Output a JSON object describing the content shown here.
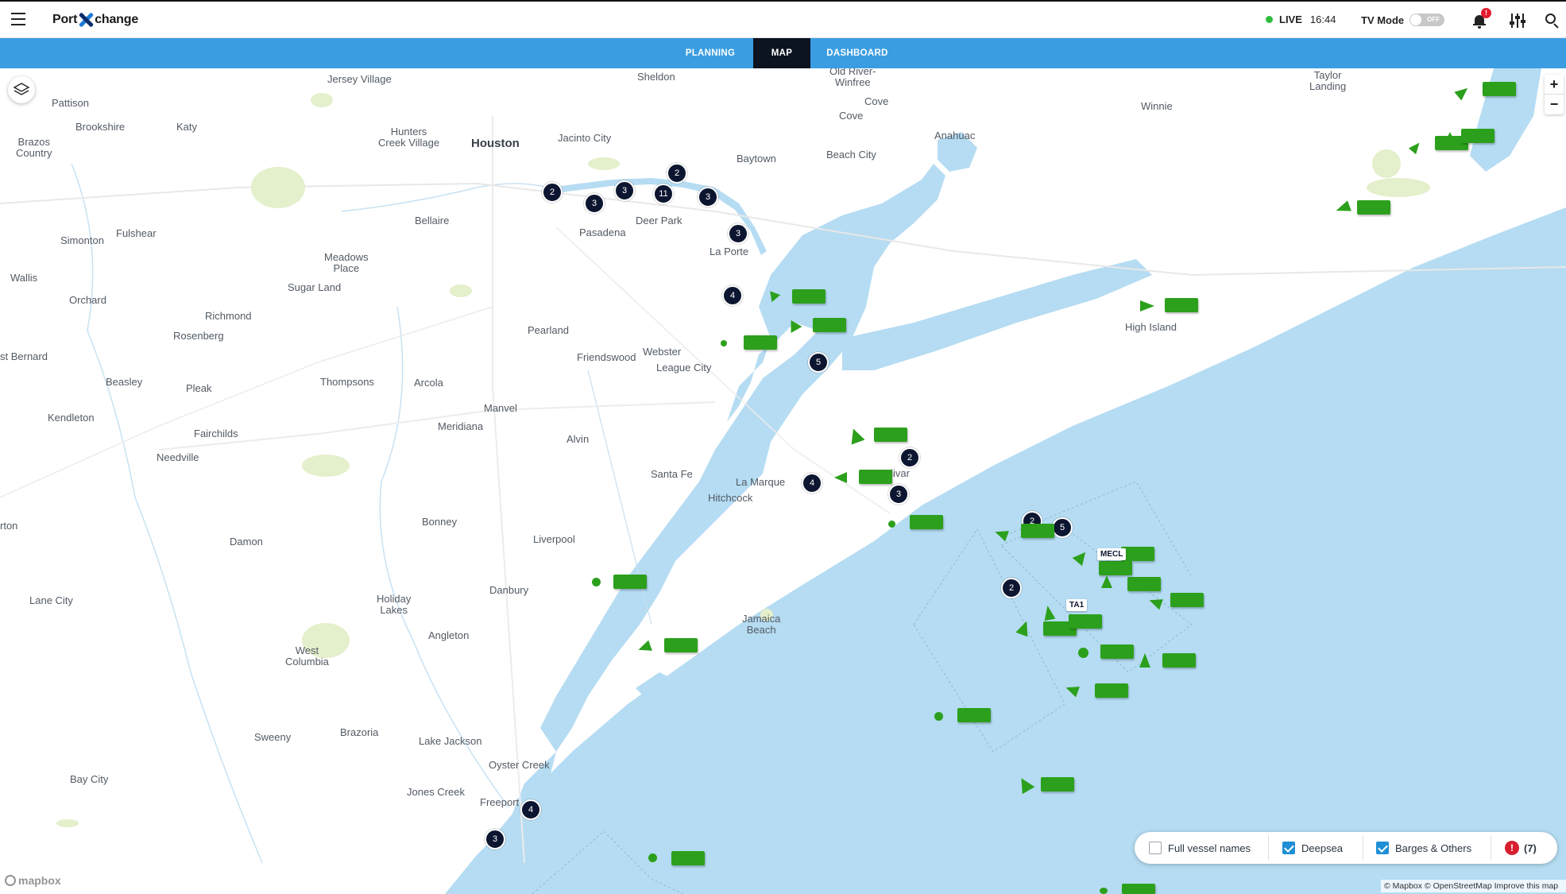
{
  "app": {
    "logo_left": "Port",
    "logo_right": "change",
    "live_label": "LIVE",
    "live_time": "16:44",
    "tv_mode_label": "TV Mode",
    "tv_toggle_label": "OFF",
    "notification_badge": "!"
  },
  "tabs": [
    {
      "label": "PLANNING"
    },
    {
      "label": "MAP"
    },
    {
      "label": "DASHBOARD"
    }
  ],
  "colors": {
    "nav": "#3a9de2",
    "active_tab": "#0c1421",
    "vessel": "#2ca01c",
    "cluster": "#0d1630",
    "water": "#b5dcf2",
    "alert": "#d71f2d"
  },
  "places": [
    {
      "name": "Jersey Village"
    },
    {
      "name": "Sheldon"
    },
    {
      "name": "Old River-\nWinfree"
    },
    {
      "name": "Taylor\nLanding"
    },
    {
      "name": "Pattison"
    },
    {
      "name": "Cove"
    },
    {
      "name": "Cove"
    },
    {
      "name": "Winnie"
    },
    {
      "name": "Brookshire"
    },
    {
      "name": "Katy"
    },
    {
      "name": "Hunters\nCreek Village"
    },
    {
      "name": "Houston"
    },
    {
      "name": "Jacinto City"
    },
    {
      "name": "Anahuac"
    },
    {
      "name": "Brazos\nCountry"
    },
    {
      "name": "Beach City"
    },
    {
      "name": "Baytown"
    },
    {
      "name": "Deer Park"
    },
    {
      "name": "Bellaire"
    },
    {
      "name": "Pasadena"
    },
    {
      "name": "Fulshear"
    },
    {
      "name": "Simonton"
    },
    {
      "name": "La Porte"
    },
    {
      "name": "Meadows\nPlace"
    },
    {
      "name": "Wallis"
    },
    {
      "name": "Sugar Land"
    },
    {
      "name": "Orchard"
    },
    {
      "name": "High Island"
    },
    {
      "name": "Richmond"
    },
    {
      "name": "Pearland"
    },
    {
      "name": "Rosenberg"
    },
    {
      "name": "Webster"
    },
    {
      "name": "Friendswood"
    },
    {
      "name": "st Bernard"
    },
    {
      "name": "League City"
    },
    {
      "name": "Beasley"
    },
    {
      "name": "Thompsons"
    },
    {
      "name": "Arcola"
    },
    {
      "name": "Pleak"
    },
    {
      "name": "Manvel"
    },
    {
      "name": "Kendleton"
    },
    {
      "name": "Meridiana"
    },
    {
      "name": "Fairchilds"
    },
    {
      "name": "Alvin"
    },
    {
      "name": "Needville"
    },
    {
      "name": "Santa Fe"
    },
    {
      "name": "La Marque"
    },
    {
      "name": "t Bolivar"
    },
    {
      "name": "Hitchcock"
    },
    {
      "name": "Bonney"
    },
    {
      "name": "rton"
    },
    {
      "name": "Damon"
    },
    {
      "name": "Liverpool"
    },
    {
      "name": "Danbury"
    },
    {
      "name": "Lane City"
    },
    {
      "name": "Holiday\nLakes"
    },
    {
      "name": "Angleton"
    },
    {
      "name": "Jamaica\nBeach"
    },
    {
      "name": "West\nColumbia"
    },
    {
      "name": "Sweeny"
    },
    {
      "name": "Brazoria"
    },
    {
      "name": "Lake Jackson"
    },
    {
      "name": "Oyster Creek"
    },
    {
      "name": "Bay City"
    },
    {
      "name": "Jones Creek"
    },
    {
      "name": "Freeport"
    }
  ],
  "clusters": [
    {
      "count": "2"
    },
    {
      "count": "3"
    },
    {
      "count": "3"
    },
    {
      "count": "11"
    },
    {
      "count": "2"
    },
    {
      "count": "3"
    },
    {
      "count": "3"
    },
    {
      "count": "4"
    },
    {
      "count": "5"
    },
    {
      "count": "2"
    },
    {
      "count": "4"
    },
    {
      "count": "3"
    },
    {
      "count": "2"
    },
    {
      "count": "5"
    },
    {
      "count": "2"
    },
    {
      "count": "4"
    },
    {
      "count": "3"
    }
  ],
  "vessel_tags": [
    {
      "name": "MECL"
    },
    {
      "name": "TA1"
    }
  ],
  "filters": {
    "full_names": {
      "label": "Full vessel names",
      "checked": false
    },
    "deepsea": {
      "label": "Deepsea",
      "checked": true
    },
    "barges": {
      "label": "Barges & Others",
      "checked": true
    },
    "alerts_count": "(7)"
  },
  "map_controls": {
    "zoom_in": "+",
    "zoom_out": "−",
    "mapbox": "mapbox",
    "attribution": "© Mapbox © OpenStreetMap Improve this map"
  }
}
